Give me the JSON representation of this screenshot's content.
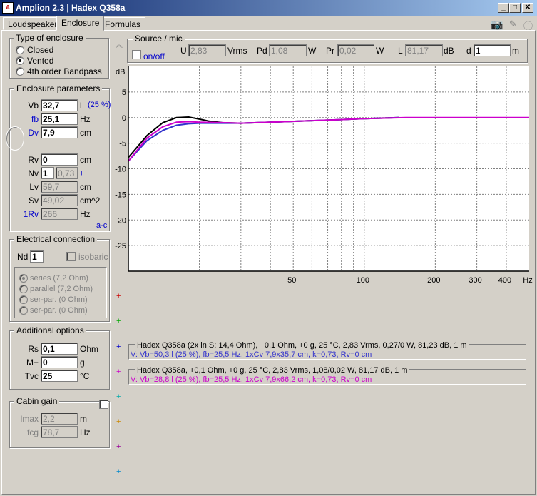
{
  "window": {
    "title": "Amplion 2.3 | Hadex Q358a",
    "app_icon": "amplion-app-icon",
    "min": "_",
    "max": "□",
    "close": "✕"
  },
  "tabs": [
    {
      "label": "Loudspeaker"
    },
    {
      "label": "Enclosure"
    },
    {
      "label": "Formulas"
    }
  ],
  "toolbar_icons": [
    "camera-icon",
    "pin-icon",
    "info-icon"
  ],
  "enclosure_type": {
    "title": "Type of enclosure",
    "options": [
      {
        "label": "Closed",
        "selected": false
      },
      {
        "label": "Vented",
        "selected": true
      },
      {
        "label": "4th order Bandpass",
        "selected": false
      }
    ]
  },
  "enclosure_params": {
    "title": "Enclosure parameters",
    "vb": {
      "label": "Vb",
      "value": "32,7",
      "unit": "l",
      "extra": "(25 %)"
    },
    "fb": {
      "label": "fb",
      "value": "25,1",
      "unit": "Hz"
    },
    "dv": {
      "label": "Dv",
      "value": "7,9",
      "unit": "cm"
    },
    "rv": {
      "label": "Rv",
      "value": "0",
      "unit": "cm"
    },
    "nv": {
      "label": "Nv",
      "value": "1",
      "value2": "0,73",
      "unit": "±"
    },
    "lv": {
      "label": "Lv",
      "value": "59,7",
      "unit": "cm"
    },
    "sv": {
      "label": "Sv",
      "value": "49,02",
      "unit": "cm^2"
    },
    "rv1": {
      "label": "1Rv",
      "value": "266",
      "unit": "Hz"
    },
    "ac": "a-c"
  },
  "electrical": {
    "title": "Electrical connection",
    "nd_label": "Nd",
    "nd_value": "1",
    "isobaric": "isobaric",
    "options": [
      {
        "label": "series (7,2 Ohm)",
        "selected": true
      },
      {
        "label": "parallel (7,2 Ohm)",
        "selected": false
      },
      {
        "label": "ser-par. (0 Ohm)",
        "selected": false
      },
      {
        "label": "ser-par. (0 Ohm)",
        "selected": false
      }
    ]
  },
  "additional": {
    "title": "Additional options",
    "rs": {
      "label": "Rs",
      "value": "0,1",
      "unit": "Ohm"
    },
    "m": {
      "label": "M+",
      "value": "0",
      "unit": "g"
    },
    "tvc": {
      "label": "Tvc",
      "value": "25",
      "unit": "°C"
    }
  },
  "cabin": {
    "title": "Cabin gain",
    "lmax": {
      "label": "lmax",
      "value": "2,2",
      "unit": "m"
    },
    "fcg": {
      "label": "fcg",
      "value": "78,7",
      "unit": "Hz"
    }
  },
  "source": {
    "title": "Source / mic",
    "onoff": "on/off",
    "u": {
      "label": "U",
      "value": "2,83",
      "unit": "Vrms"
    },
    "pd": {
      "label": "Pd",
      "value": "1,08",
      "unit": "W"
    },
    "pr": {
      "label": "Pr",
      "value": "0,02",
      "unit": "W"
    },
    "l": {
      "label": "L",
      "value": "81,17",
      "unit": "dB"
    },
    "d": {
      "label": "d",
      "value": "1",
      "unit": "m"
    }
  },
  "chart_data": {
    "type": "line",
    "ylabel": "dB",
    "xlabel": "Hz",
    "xscale": "log",
    "xlim": [
      10,
      500
    ],
    "ylim": [
      -30,
      10
    ],
    "y_ticks": [
      5,
      0,
      -5,
      -10,
      -15,
      -20,
      -25
    ],
    "x_tick_labels": [
      {
        "x": 50,
        "label": "50"
      },
      {
        "x": 100,
        "label": "100"
      },
      {
        "x": 200,
        "label": "200"
      },
      {
        "x": 300,
        "label": "300"
      },
      {
        "x": 400,
        "label": "400"
      },
      {
        "x": 500,
        "label": "Hz"
      }
    ],
    "x_grid": [
      20,
      30,
      40,
      50,
      60,
      70,
      80,
      90,
      100,
      200,
      300,
      400
    ],
    "grid": true,
    "series": [
      {
        "color": "#000000",
        "points": [
          [
            10,
            -7.8
          ],
          [
            12,
            -3.5
          ],
          [
            14,
            -1
          ],
          [
            16,
            0
          ],
          [
            18,
            0.1
          ],
          [
            20,
            -0.3
          ],
          [
            22,
            -0.7
          ],
          [
            25,
            -1
          ],
          [
            30,
            -1.1
          ],
          [
            40,
            -0.9
          ],
          [
            60,
            -0.6
          ],
          [
            80,
            -0.4
          ],
          [
            100,
            -0.2
          ],
          [
            120,
            -0.1
          ],
          [
            140,
            0
          ]
        ]
      },
      {
        "color": "#3333cc",
        "points": [
          [
            10,
            -8.5
          ],
          [
            12,
            -4.5
          ],
          [
            14,
            -2.5
          ],
          [
            16,
            -1.5
          ],
          [
            18,
            -1.2
          ],
          [
            20,
            -1.1
          ],
          [
            25,
            -1.1
          ],
          [
            30,
            -1.1
          ],
          [
            40,
            -0.9
          ],
          [
            60,
            -0.6
          ],
          [
            80,
            -0.4
          ],
          [
            100,
            -0.2
          ],
          [
            120,
            -0.1
          ],
          [
            140,
            0
          ]
        ]
      },
      {
        "color": "#cc00cc",
        "points": [
          [
            10,
            -8.5
          ],
          [
            12,
            -4
          ],
          [
            14,
            -1.8
          ],
          [
            16,
            -0.9
          ],
          [
            18,
            -0.8
          ],
          [
            20,
            -0.9
          ],
          [
            25,
            -1
          ],
          [
            30,
            -1.1
          ],
          [
            40,
            -0.9
          ],
          [
            60,
            -0.6
          ],
          [
            80,
            -0.4
          ],
          [
            100,
            -0.2
          ],
          [
            150,
            0
          ],
          [
            200,
            0
          ],
          [
            500,
            0
          ]
        ]
      }
    ]
  },
  "markers": [
    {
      "color": "#cc0000"
    },
    {
      "color": "#00aa00"
    },
    {
      "color": "#0000cc"
    },
    {
      "color": "#cc00cc"
    },
    {
      "color": "#00aaaa"
    },
    {
      "color": "#cc8800"
    },
    {
      "color": "#990099"
    },
    {
      "color": "#0088cc"
    }
  ],
  "legend": [
    {
      "line1": "Hadex Q358a (2x in S: 14,4 Ohm), +0,1 Ohm, +0 g, 25 °C, 2,83 Vrms, 0,27/0 W, 81,23 dB, 1 m",
      "line2": "V: Vb=50,3 l (25 %), fb=25,5 Hz, 1xCv 7,9x35,7 cm, k=0,73, Rv=0 cm",
      "color": "#3333cc"
    },
    {
      "line1": "Hadex Q358a, +0,1 Ohm, +0 g, 25 °C, 2,83 Vrms, 1,08/0,02 W, 81,17 dB, 1 m",
      "line2": "V: Vb=28,8 l (25 %), fb=25,5 Hz, 1xCv 7,9x66,2 cm, k=0,73, Rv=0 cm",
      "color": "#cc00cc"
    }
  ]
}
